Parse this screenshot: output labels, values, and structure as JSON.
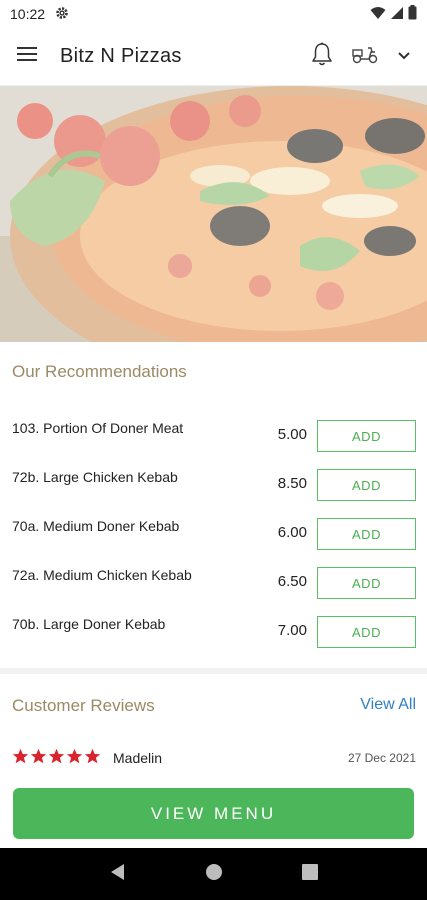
{
  "status_bar": {
    "time": "10:22"
  },
  "app_bar": {
    "title": "Bitz N Pizzas"
  },
  "recommendations": {
    "title": "Our Recommendations",
    "items": [
      {
        "name": "103. Portion Of Doner Meat",
        "price": "5.00",
        "button": "ADD"
      },
      {
        "name": "72b. Large Chicken Kebab",
        "price": "8.50",
        "button": "ADD"
      },
      {
        "name": "70a. Medium Doner Kebab",
        "price": "6.00",
        "button": "ADD"
      },
      {
        "name": "72a. Medium Chicken Kebab",
        "price": "6.50",
        "button": "ADD"
      },
      {
        "name": "70b. Large Doner Kebab",
        "price": "7.00",
        "button": "ADD"
      }
    ]
  },
  "reviews": {
    "title": "Customer Reviews",
    "view_all": "View All",
    "items": [
      {
        "rating": 5,
        "reviewer": "Madelin",
        "date": "27 Dec 2021"
      }
    ]
  },
  "view_menu_button": "VIEW MENU",
  "colors": {
    "accent_green": "#4cb75a",
    "section_title": "#9b8a66",
    "link_blue": "#2f80c5",
    "star_red": "#d9232d"
  },
  "icons": {
    "status": [
      "gear-icon",
      "wifi-icon",
      "signal-icon",
      "battery-icon"
    ],
    "app_bar": [
      "menu-icon",
      "bell-icon",
      "delivery-scooter-icon",
      "chevron-down-icon"
    ],
    "nav": [
      "back-icon",
      "home-icon",
      "recents-icon"
    ]
  }
}
